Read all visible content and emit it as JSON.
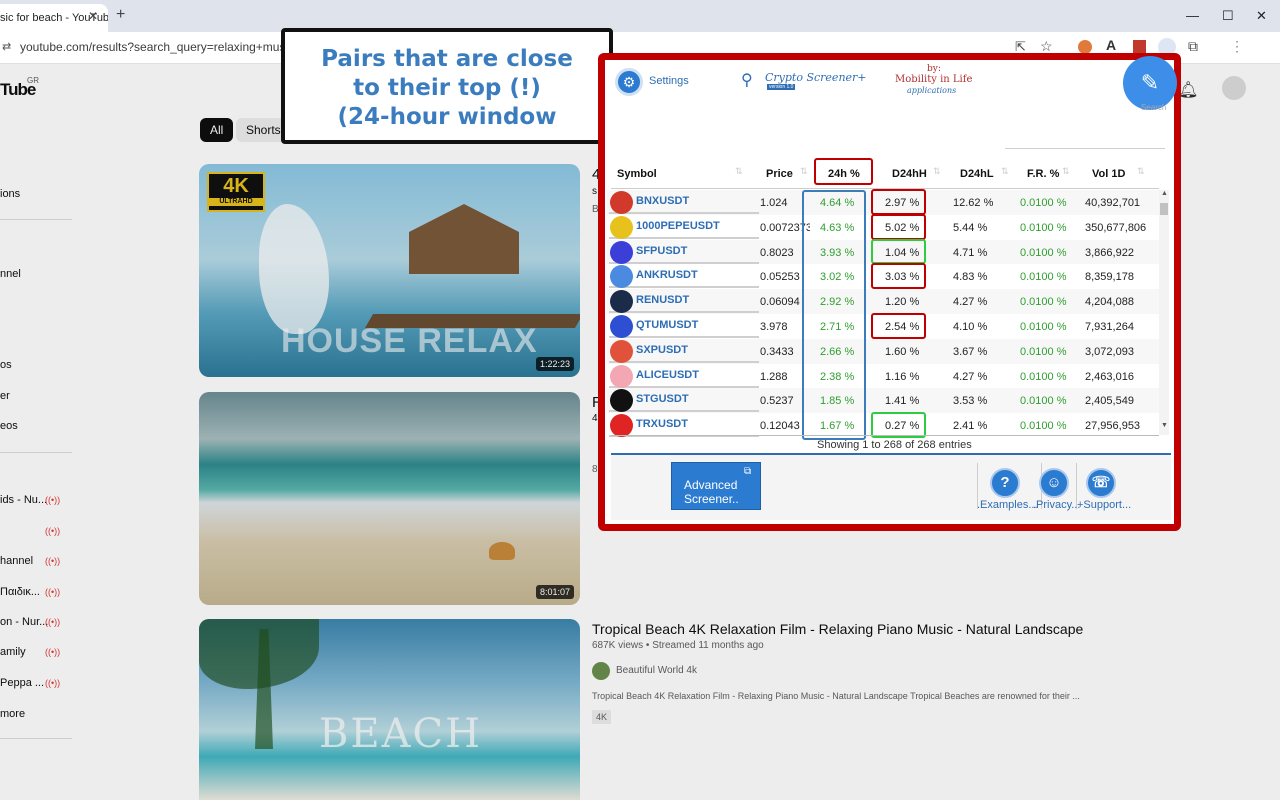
{
  "browser": {
    "tab_title": "sic for beach - YouTube",
    "url": "youtube.com/results?search_query=relaxing+music+fo"
  },
  "youtube": {
    "logo": "Tube",
    "region": "GR",
    "chips": [
      "All",
      "Shorts"
    ],
    "sidebar": [
      {
        "label": "ions",
        "live": false
      },
      {
        "label": "nnel",
        "live": false
      },
      {
        "label": "os",
        "live": false
      },
      {
        "label": "er",
        "live": false
      },
      {
        "label": "eos",
        "live": false
      },
      {
        "label": "ids - Nu...",
        "live": true
      },
      {
        "label": "",
        "live": true
      },
      {
        "label": "hannel",
        "live": true
      },
      {
        "label": " Παιδικ...",
        "live": true
      },
      {
        "label": "on - Nur...",
        "live": true
      },
      {
        "label": "amily",
        "live": true
      },
      {
        "label": "Peppa ...",
        "live": true
      },
      {
        "label": "more",
        "live": false
      }
    ],
    "videos": [
      {
        "thumb_text": "HOUSE RELAX",
        "badge": "4K",
        "badge_sub": "ULTRAHD",
        "duration": "1:22:23"
      },
      {
        "thumb_text": "",
        "duration": "8:01:07"
      },
      {
        "thumb_text": "BEACH"
      }
    ],
    "result3": {
      "title": "Tropical Beach 4K Relaxation Film - Relaxing Piano Music - Natural Landscape",
      "meta": "687K views • Streamed 11 months ago",
      "channel": "Beautiful World 4k",
      "description": "Tropical Beach 4K Relaxation Film - Relaxing Piano Music - Natural Landscape Tropical Beaches are renowned for their ...",
      "tag": "4K"
    },
    "partial": {
      "row1a": "4",
      "row1b": "s",
      "row1c": "B",
      "row2a": "R",
      "row2b": "4",
      "row2c": "8"
    }
  },
  "callout": {
    "lines": [
      "Pairs that are close",
      "to their top (!)",
      "(24-hour window"
    ]
  },
  "extension": {
    "settings_label": "Settings",
    "app_name": "Crypto Screener+",
    "app_version": "version 1.0",
    "by_label": "by:",
    "company": "Mobility in Life",
    "company_sub": "applications",
    "search_label": "Search",
    "columns": [
      "Symbol",
      "Price",
      "24h %",
      "D24hH",
      "D24hL",
      "F.R. %",
      "Vol 1D"
    ],
    "rows": [
      {
        "symbol": "BNXUSDT",
        "price": "1.024",
        "change": "4.64 %",
        "d24hh": "2.97 %",
        "d24hl": "12.62 %",
        "fr": "0.0100 %",
        "vol": "40,392,701",
        "coin_color": "#d13a2a",
        "hh_mark": "red"
      },
      {
        "symbol": "1000PEPEUSDT",
        "price": "0.0072373",
        "change": "4.63 %",
        "d24hh": "5.02 %",
        "d24hl": "5.44 %",
        "fr": "0.0100 %",
        "vol": "350,677,806",
        "coin_color": "#e8c21c",
        "hh_mark": "red"
      },
      {
        "symbol": "SFPUSDT",
        "price": "0.8023",
        "change": "3.93 %",
        "d24hh": "1.04 %",
        "d24hl": "4.71 %",
        "fr": "0.0100 %",
        "vol": "3,866,922",
        "coin_color": "#3b3fd8",
        "hh_mark": "green"
      },
      {
        "symbol": "ANKRUSDT",
        "price": "0.05253",
        "change": "3.02 %",
        "d24hh": "3.03 %",
        "d24hl": "4.83 %",
        "fr": "0.0100 %",
        "vol": "8,359,178",
        "coin_color": "#4a8ae0",
        "hh_mark": "red"
      },
      {
        "symbol": "RENUSDT",
        "price": "0.06094",
        "change": "2.92 %",
        "d24hh": "1.20 %",
        "d24hl": "4.27 %",
        "fr": "0.0100 %",
        "vol": "4,204,088",
        "coin_color": "#1a2c48",
        "hh_mark": "none"
      },
      {
        "symbol": "QTUMUSDT",
        "price": "3.978",
        "change": "2.71 %",
        "d24hh": "2.54 %",
        "d24hl": "4.10 %",
        "fr": "0.0100 %",
        "vol": "7,931,264",
        "coin_color": "#2e4fd4",
        "hh_mark": "red"
      },
      {
        "symbol": "SXPUSDT",
        "price": "0.3433",
        "change": "2.66 %",
        "d24hh": "1.60 %",
        "d24hl": "3.67 %",
        "fr": "0.0100 %",
        "vol": "3,072,093",
        "coin_color": "#e0533a",
        "hh_mark": "none"
      },
      {
        "symbol": "ALICEUSDT",
        "price": "1.288",
        "change": "2.38 %",
        "d24hh": "1.16 %",
        "d24hl": "4.27 %",
        "fr": "0.0100 %",
        "vol": "2,463,016",
        "coin_color": "#f2a7b3",
        "hh_mark": "none"
      },
      {
        "symbol": "STGUSDT",
        "price": "0.5237",
        "change": "1.85 %",
        "d24hh": "1.41 %",
        "d24hl": "3.53 %",
        "fr": "0.0100 %",
        "vol": "2,405,549",
        "coin_color": "#111111",
        "hh_mark": "none"
      },
      {
        "symbol": "TRXUSDT",
        "price": "0.12043",
        "change": "1.67 %",
        "d24hh": "0.27 %",
        "d24hl": "2.41 %",
        "fr": "0.0100 %",
        "vol": "27,956,953",
        "coin_color": "#e02424",
        "hh_mark": "green"
      }
    ],
    "footer_info": "Showing 1 to 268 of 268 entries",
    "advanced_button": [
      "Advanced",
      "Screener.."
    ],
    "bottom_buttons": [
      {
        "label": ".Examples...",
        "icon": "?"
      },
      {
        "label": ".Privacy...",
        "icon": "user"
      },
      {
        "label": "+Support...",
        "icon": "phone"
      }
    ],
    "colors": {
      "frame": "#c00000",
      "accent": "#2e6db4",
      "positive": "#2f9e2f",
      "near_top": "#2ecc40"
    }
  }
}
